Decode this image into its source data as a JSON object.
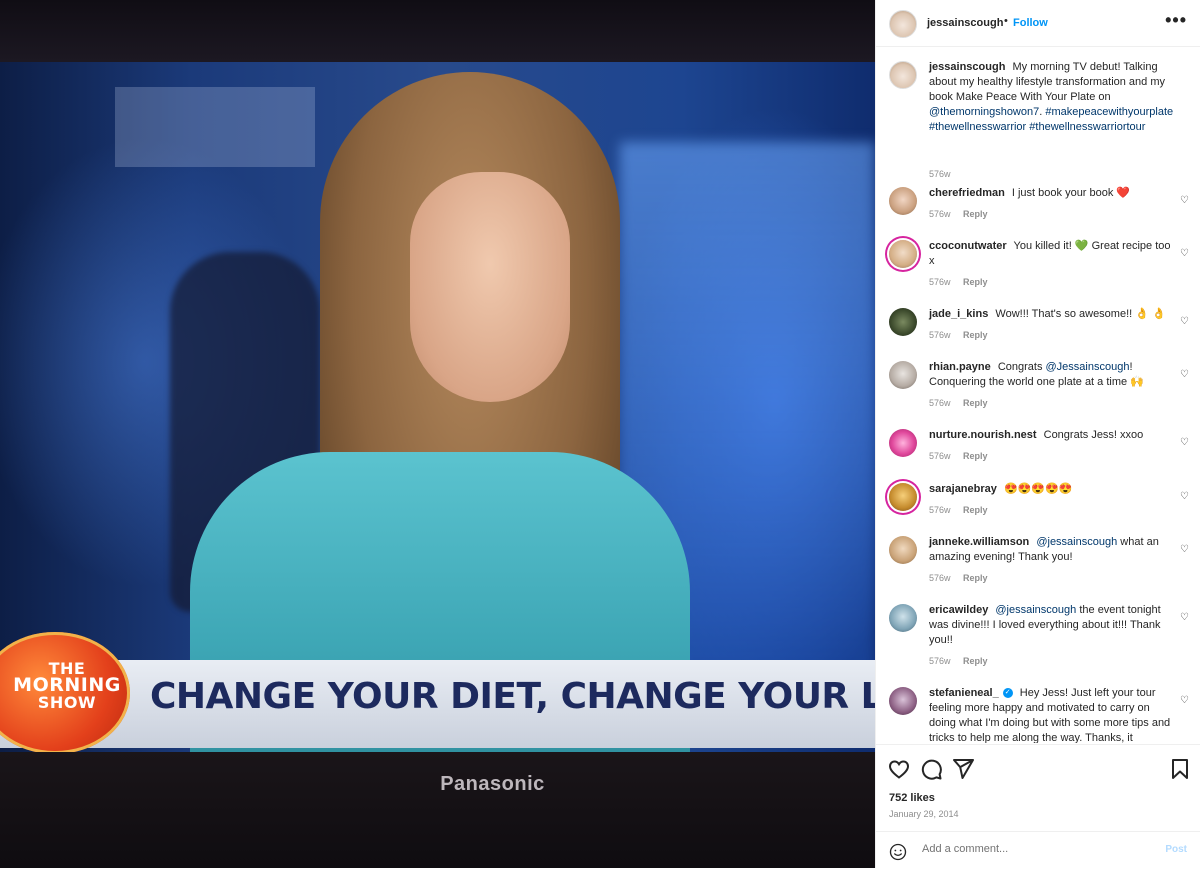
{
  "media": {
    "logo_line1": "THE",
    "logo_line2": "MORNING",
    "logo_line3": "SHOW",
    "headline": "CHANGE YOUR DIET, CHANGE YOUR LIFE",
    "tv_brand": "Panasonic"
  },
  "header": {
    "username": "jessainscough",
    "separator": "•",
    "follow": "Follow",
    "more": "•••"
  },
  "caption": {
    "username": "jessainscough",
    "text": "My morning TV debut! Talking about my healthy lifestyle transformation and my book Make Peace With Your Plate on",
    "mention": "@themorningshowon7",
    "period": ".",
    "tag1": "#makepeacewithyourplate",
    "tag2": "#thewellnesswarrior",
    "tag3": "#thewellnesswarriortour",
    "time": "576w"
  },
  "comments": [
    {
      "username": "cherefriedman",
      "text": "I just book your book ❤️",
      "time": "576w",
      "reply": "Reply"
    },
    {
      "username": "ccoconutwater",
      "text": "You killed it! 💚 Great recipe too x",
      "time": "576w",
      "reply": "Reply"
    },
    {
      "username": "jade_i_kins",
      "text": "Wow!!! That's so awesome!! 👌 👌",
      "time": "576w",
      "reply": "Reply"
    },
    {
      "username": "rhian.payne",
      "pre": "Congrats",
      "mention": "@Jessainscough",
      "text": "! Conquering the world one plate at a time 🙌",
      "time": "576w",
      "reply": "Reply"
    },
    {
      "username": "nurture.nourish.nest",
      "text": "Congrats Jess! xxoo",
      "time": "576w",
      "reply": "Reply"
    },
    {
      "username": "sarajanebray",
      "text": "😍😍😍😍😍",
      "time": "576w",
      "reply": "Reply"
    },
    {
      "username": "janneke.williamson",
      "mention": "@jessainscough",
      "text": "what an amazing evening! Thank you!",
      "time": "576w",
      "reply": "Reply"
    },
    {
      "username": "ericawildey",
      "mention": "@jessainscough",
      "text": "the event tonight was divine!!! I loved everything about it!!! Thank you!!",
      "time": "576w",
      "reply": "Reply"
    },
    {
      "username": "stefanieneal_",
      "text": "Hey Jess! Just left your tour feeling more happy and motivated to carry on doing what I'm doing but with some more tips and tricks to help me along the way. Thanks, it"
    }
  ],
  "footer": {
    "likes": "752 likes",
    "date": "January 29, 2014",
    "comment_placeholder": "Add a comment...",
    "post": "Post"
  },
  "icons": {
    "like": "heart-icon",
    "comment": "comment-icon",
    "share": "send-icon",
    "save": "bookmark-icon",
    "emoji": "emoji-icon"
  },
  "colors": {
    "link": "#0095f6",
    "mention": "#00376b",
    "muted": "#8e8e8e",
    "story_ring": "#d6249f"
  }
}
